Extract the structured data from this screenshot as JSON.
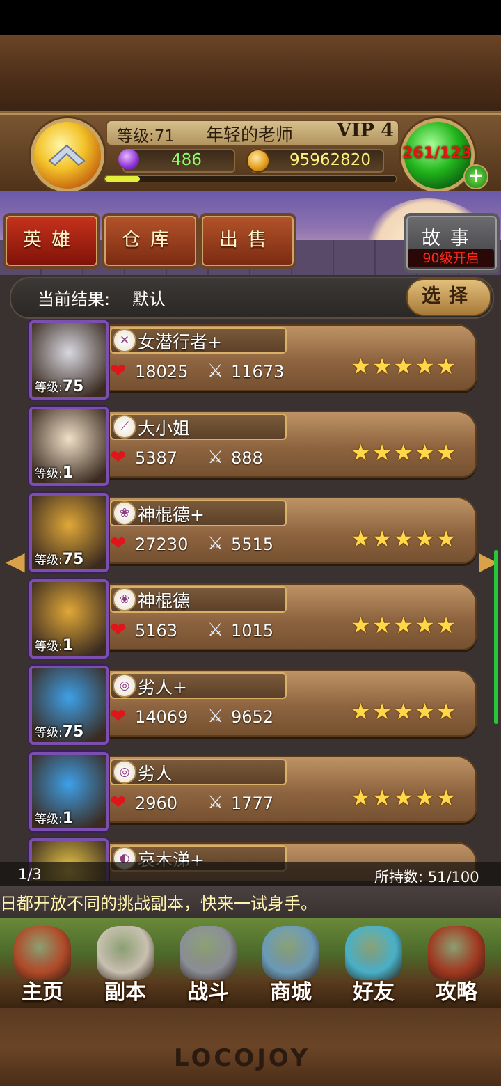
{
  "header": {
    "level_label": "等级:71",
    "player_name": "年轻的老师",
    "vip": "VIP 4",
    "gems": "486",
    "gold": "95962820",
    "stamina": "261/123",
    "exp_progress": 0.12
  },
  "tabs": [
    {
      "label": "英雄",
      "active": true
    },
    {
      "label": "仓库",
      "active": false
    },
    {
      "label": "出售",
      "active": false
    }
  ],
  "story": {
    "label": "故事",
    "sub": "90级开启"
  },
  "filter": {
    "label": "当前结果:",
    "value": "默认",
    "select_label": "选择"
  },
  "heroes": [
    {
      "name": "女潜行者+",
      "level_label": "等级:",
      "level": "75",
      "hp": "18025",
      "atk": "11673",
      "stars": 5,
      "class_icon": "dagger-icon",
      "portrait_color": "#d8d8e0"
    },
    {
      "name": "大小姐",
      "level_label": "等级:",
      "level": "1",
      "hp": "5387",
      "atk": "888",
      "stars": 5,
      "class_icon": "wand-icon",
      "portrait_color": "#f0e0c8"
    },
    {
      "name": "神棍德+",
      "level_label": "等级:",
      "level": "75",
      "hp": "27230",
      "atk": "5515",
      "stars": 5,
      "class_icon": "paw-icon",
      "portrait_color": "#e0a838"
    },
    {
      "name": "神棍德",
      "level_label": "等级:",
      "level": "1",
      "hp": "5163",
      "atk": "1015",
      "stars": 5,
      "class_icon": "paw-icon",
      "portrait_color": "#e0a838"
    },
    {
      "name": "劣人+",
      "level_label": "等级:",
      "level": "75",
      "hp": "14069",
      "atk": "9652",
      "stars": 5,
      "class_icon": "bow-icon",
      "portrait_color": "#3ea0e8"
    },
    {
      "name": "劣人",
      "level_label": "等级:",
      "level": "1",
      "hp": "2960",
      "atk": "1777",
      "stars": 5,
      "class_icon": "bow-icon",
      "portrait_color": "#3ea0e8"
    },
    {
      "name": "哀木涕+",
      "level_label": "",
      "level": "",
      "hp": "",
      "atk": "",
      "stars": 0,
      "class_icon": "shield-icon",
      "portrait_color": "#e8c848"
    }
  ],
  "list_footer": {
    "page": "1/3",
    "count": "所持数: 51/100"
  },
  "marquee": "日都开放不同的挑战副本，快来一试身手。",
  "nav": [
    {
      "label": "主页",
      "icon": "house-icon",
      "color": "#b04a28"
    },
    {
      "label": "副本",
      "icon": "skull-icon",
      "color": "#c8c0b0"
    },
    {
      "label": "战斗",
      "icon": "sword-icon",
      "color": "#8a8e96"
    },
    {
      "label": "商城",
      "icon": "monster-icon",
      "color": "#6a9ab8"
    },
    {
      "label": "好友",
      "icon": "friends-icon",
      "color": "#48b0c8"
    },
    {
      "label": "攻略",
      "icon": "book-icon",
      "color": "#a03820"
    }
  ],
  "brand": "LOCOJOY"
}
